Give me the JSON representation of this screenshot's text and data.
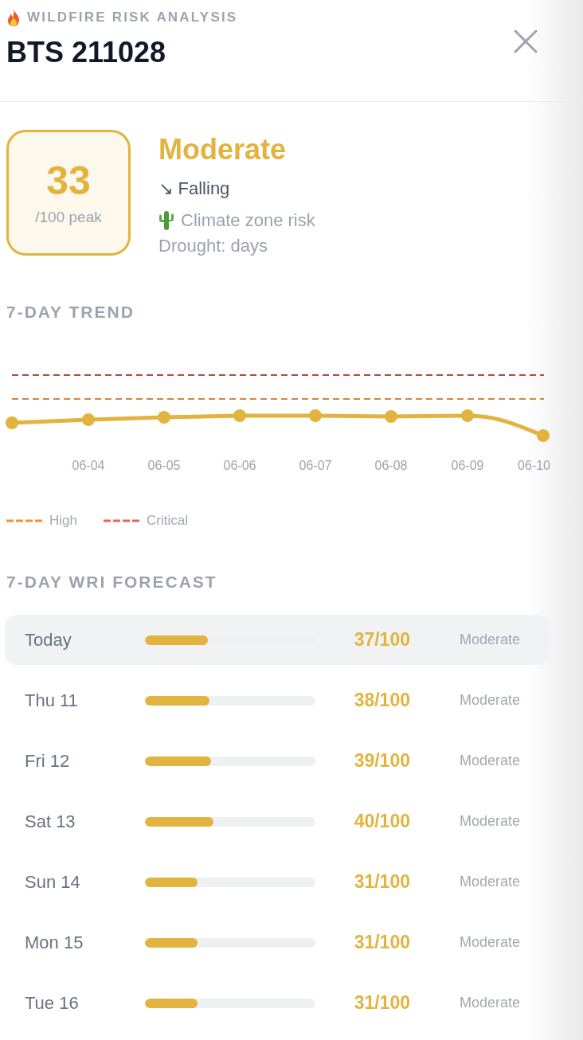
{
  "header": {
    "eyebrow": "WILDFIRE RISK ANALYSIS",
    "title": "BTS 211028"
  },
  "summary": {
    "score": "33",
    "score_caption": "/100 peak",
    "category": "Moderate",
    "trend": "↘ Falling",
    "climate_note": "Climate zone risk",
    "drought": "Drought: days"
  },
  "trend": {
    "title": "7-DAY TREND",
    "x_labels": [
      "06-04",
      "06-05",
      "06-06",
      "06-07",
      "06-08",
      "06-09",
      "06-10"
    ],
    "legend": [
      {
        "kind": "high",
        "label": "High"
      },
      {
        "kind": "critical",
        "label": "Critical"
      }
    ]
  },
  "forecast": {
    "title": "7-DAY WRI FORECAST",
    "rows": [
      {
        "day": "Today",
        "level": 0.37,
        "value": "37/100",
        "category": "Moderate",
        "current": true
      },
      {
        "day": "Thu 11",
        "level": 0.38,
        "value": "38/100",
        "category": "Moderate",
        "current": false
      },
      {
        "day": "Fri 12",
        "level": 0.39,
        "value": "39/100",
        "category": "Moderate",
        "current": false
      },
      {
        "day": "Sat 13",
        "level": 0.4,
        "value": "40/100",
        "category": "Moderate",
        "current": false
      },
      {
        "day": "Sun 14",
        "level": 0.31,
        "value": "31/100",
        "category": "Moderate",
        "current": false
      },
      {
        "day": "Mon 15",
        "level": 0.31,
        "value": "31/100",
        "category": "Moderate",
        "current": false
      },
      {
        "day": "Tue 16",
        "level": 0.31,
        "value": "31/100",
        "category": "Moderate",
        "current": false
      }
    ]
  }
}
